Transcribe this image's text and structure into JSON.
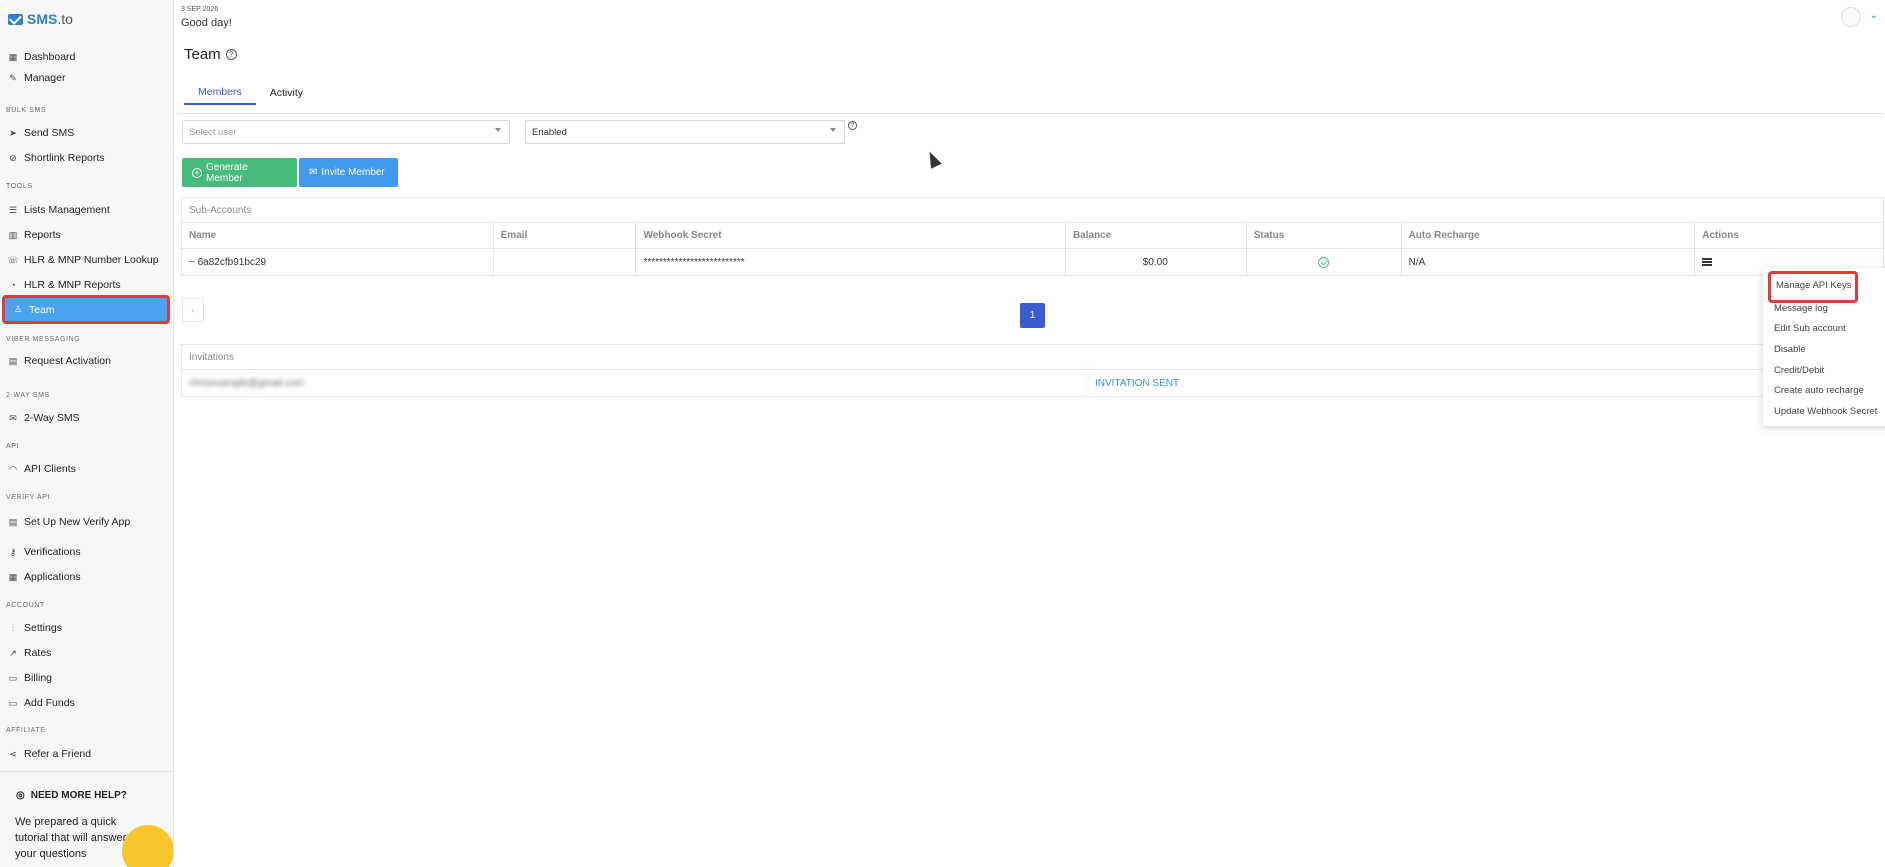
{
  "brand": {
    "name": "SMS",
    "suffix": ".to"
  },
  "sidebar": {
    "items": [
      {
        "label": "Dashboard",
        "icon": "grid-icon"
      },
      {
        "label": "Manager",
        "icon": "pen-icon"
      },
      {
        "label": "Send SMS",
        "icon": "send-icon"
      },
      {
        "label": "Shortlink Reports",
        "icon": "link-icon"
      },
      {
        "label": "Lists Management",
        "icon": "list-icon"
      },
      {
        "label": "Reports",
        "icon": "bar-chart-icon"
      },
      {
        "label": "HLR & MNP Number Lookup",
        "icon": "phone-icon"
      },
      {
        "label": "HLR & MNP Reports",
        "icon": "report-icon"
      },
      {
        "label": "Team",
        "icon": "user-icon"
      },
      {
        "label": "Request Activation",
        "icon": "document-icon"
      },
      {
        "label": "2-Way SMS",
        "icon": "envelope-icon"
      },
      {
        "label": "API Clients",
        "icon": "rss-icon"
      },
      {
        "label": "Set Up New Verify App",
        "icon": "document-icon"
      },
      {
        "label": "Verifications",
        "icon": "key-icon"
      },
      {
        "label": "Applications",
        "icon": "grid-icon"
      },
      {
        "label": "Settings",
        "icon": "sliders-icon"
      },
      {
        "label": "Rates",
        "icon": "trend-icon"
      },
      {
        "label": "Billing",
        "icon": "calendar-icon"
      },
      {
        "label": "Add Funds",
        "icon": "card-icon"
      },
      {
        "label": "Refer a Friend",
        "icon": "share-icon"
      }
    ],
    "sections": [
      "BULK SMS",
      "TOOLS",
      "VIBER MESSAGING",
      "2-WAY SMS",
      "API",
      "VERIFY API",
      "ACCOUNT",
      "AFFILIATE"
    ],
    "help": {
      "title": "NEED MORE HELP?",
      "text": "We prepared a quick tutorial that will answer all your questions"
    }
  },
  "header": {
    "date": "3 SEP 2026",
    "greeting": "Good day!"
  },
  "page": {
    "title": "Team"
  },
  "tabs": [
    "Members",
    "Activity"
  ],
  "filters": {
    "user_placeholder": "Select user",
    "status_value": "Enabled"
  },
  "buttons": {
    "generate": "Generate Member",
    "invite": "Invite Member"
  },
  "subaccounts": {
    "title": "Sub-Accounts",
    "columns": [
      "Name",
      "Email",
      "Webhook Secret",
      "Balance",
      "Status",
      "Auto Recharge",
      "Actions"
    ],
    "rows": [
      {
        "name": "~ 6a82cfb91bc29",
        "email": "",
        "webhook": "**************************",
        "balance": "$0.00",
        "auto_recharge": "N/A"
      }
    ]
  },
  "pagination": {
    "current": "1",
    "prev": "‹",
    "next": "›"
  },
  "invitations": {
    "title": "Invitations",
    "rows": [
      {
        "email": "chrisexample@gmail.com",
        "status": "INVITATION SENT"
      }
    ]
  },
  "actions_menu": [
    "Manage API Keys",
    "Message log",
    "Edit Sub account",
    "Disable",
    "Credit/Debit",
    "Create auto recharge",
    "Update Webhook Secret"
  ],
  "colors": {
    "accent": "#3a5bd1",
    "active_nav": "#4aa3f0",
    "highlight": "#e23b3b",
    "green": "#47bb7c",
    "blue_btn": "#3f9af0"
  }
}
